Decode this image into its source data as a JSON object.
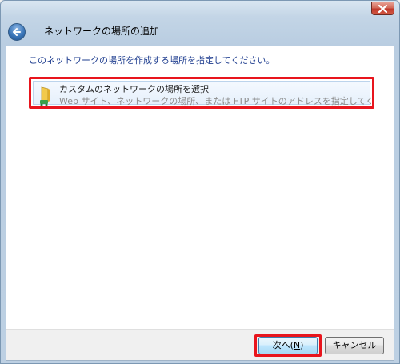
{
  "window": {
    "title": "ネットワークの場所の追加"
  },
  "content": {
    "instruction": "このネットワークの場所を作成する場所を指定してください。",
    "option": {
      "title": "カスタムのネットワークの場所を選択",
      "description": "Web サイト、ネットワークの場所、または FTP サイトのアドレスを指定してくださ…"
    }
  },
  "footer": {
    "next_label_pre": "次へ(",
    "next_label_key": "N",
    "next_label_post": ")",
    "cancel_label": "キャンセル"
  },
  "colors": {
    "highlight": "#e8151d",
    "instruction_text": "#1e3d8f"
  },
  "icons": {
    "close": "close-icon",
    "back": "back-arrow-icon",
    "option": "network-folder-icon"
  }
}
